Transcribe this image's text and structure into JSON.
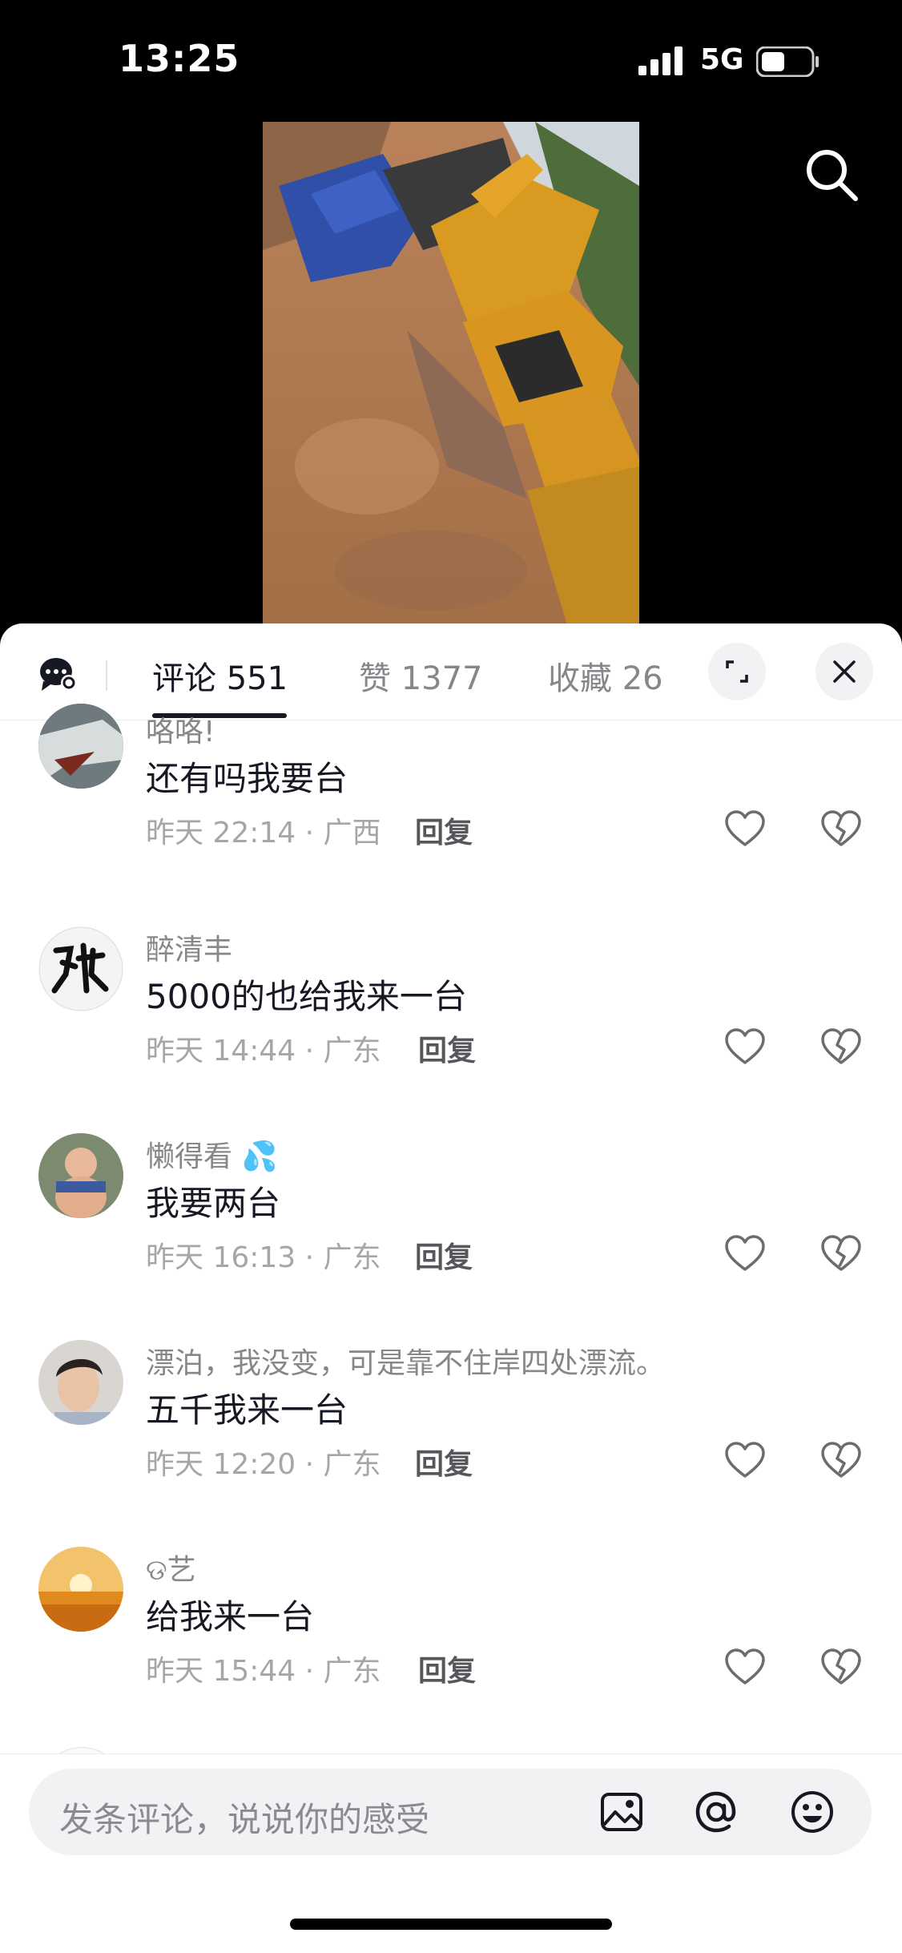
{
  "status_bar": {
    "time": "13:25",
    "network": "5G"
  },
  "tabs": [
    {
      "label": "评论 551",
      "active": true
    },
    {
      "label": "赞 1377",
      "active": false
    },
    {
      "label": "收藏 26",
      "active": false
    }
  ],
  "comments": [
    {
      "user": "咯咯!",
      "text": "还有吗我要台",
      "meta": "昨天 22:14 · 广西",
      "reply": "回复"
    },
    {
      "user": "醉清丰",
      "text": "5000的也给我来一台",
      "meta": "昨天 14:44 · 广东",
      "reply": "回复"
    },
    {
      "user": "懒得看 💦",
      "text": "我要两台",
      "meta": "昨天 16:13 · 广东",
      "reply": "回复"
    },
    {
      "user": "漂泊，我没变，可是靠不住岸四处漂流。",
      "text": "五千我来一台",
      "meta": "昨天 12:20 · 广东",
      "reply": "回复"
    },
    {
      "user": "ଡ艺",
      "text": "给我来一台",
      "meta": "昨天 15:44 · 广东",
      "reply": "回复"
    }
  ],
  "input": {
    "placeholder": "发条评论，说说你的感受"
  },
  "icons": {
    "search": "search-icon",
    "chat": "chat-settings-icon",
    "expand": "expand-icon",
    "close": "close-icon",
    "like": "heart-icon",
    "dislike": "broken-heart-icon",
    "image": "image-icon",
    "mention": "at-icon",
    "emoji": "emoji-icon"
  },
  "colors": {
    "background": "#000000",
    "panel": "#ffffff",
    "muted_text": "#86878b"
  }
}
